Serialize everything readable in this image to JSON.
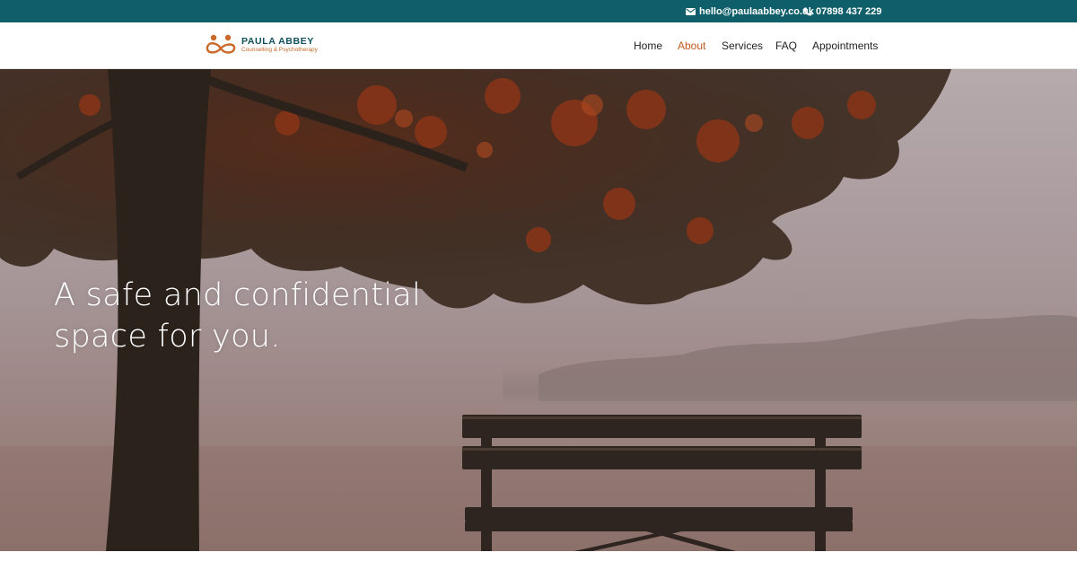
{
  "topbar": {
    "email": "hello@paulaabbey.co.uk",
    "phone": "07898 437 229",
    "bg_color": "#0f5f6b"
  },
  "brand": {
    "name": "PAULA ABBEY",
    "tagline": "Counselling & Psychotherapy",
    "primary_color": "#0f4f5c",
    "accent_color": "#c9692a"
  },
  "nav": {
    "items": [
      {
        "label": "Home",
        "active": false
      },
      {
        "label": "About",
        "active": true
      },
      {
        "label": "Services",
        "active": false
      },
      {
        "label": "FAQ",
        "active": false
      },
      {
        "label": "Appointments",
        "active": false
      }
    ],
    "active_color": "#c0581f"
  },
  "hero": {
    "line1": "A safe and confidential",
    "line2": "space for you.",
    "image": "autumn-tree-and-bench-by-misty-lake"
  },
  "icons": {
    "email": "envelope-icon",
    "phone": "phone-icon",
    "logo": "two-figures-infinity-icon"
  }
}
